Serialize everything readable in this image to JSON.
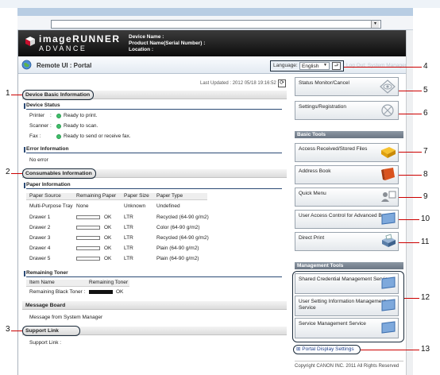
{
  "header": {
    "brand_line1": "imageRUNNER",
    "brand_line2": "ADVANCE",
    "device_name": "Device Name :",
    "product_name": "Product Name(Serial Number) :",
    "location": "Location :"
  },
  "portal": {
    "title": "Remote UI : Portal",
    "language_label": "Language:",
    "language_value": "English",
    "system_manager": "Log Out: System Manager",
    "last_updated": "Last Updated : 2012 05/18 19:16:52"
  },
  "device_basic": {
    "title": "Device Basic Information",
    "status_title": "Device Status",
    "rows": [
      {
        "label": "Printer",
        "sep": ":",
        "value": "Ready to print."
      },
      {
        "label": "Scanner",
        "sep": ":",
        "value": "Ready to scan."
      },
      {
        "label": "Fax :",
        "sep": "",
        "value": "Ready to send or receive fax."
      }
    ],
    "error_title": "Error Information",
    "error_text": "No error"
  },
  "consumables": {
    "title": "Consumables Information",
    "paper_title": "Paper Information",
    "headers": [
      "Paper Source",
      "Remaining Paper",
      "Paper Size",
      "Paper Type"
    ],
    "rows": [
      {
        "source": "Multi-Purpose Tray",
        "remaining": "None",
        "size": "Unknown",
        "type": "Undefined"
      },
      {
        "source": "Drawer 1",
        "remaining": "OK",
        "size": "LTR",
        "type": "Recycled (64-90 g/m2)"
      },
      {
        "source": "Drawer 2",
        "remaining": "OK",
        "size": "LTR",
        "type": "Color (64-90 g/m2)"
      },
      {
        "source": "Drawer 3",
        "remaining": "OK",
        "size": "LTR",
        "type": "Recycled (64-90 g/m2)"
      },
      {
        "source": "Drawer 4",
        "remaining": "OK",
        "size": "LTR",
        "type": "Plain (64-90 g/m2)"
      },
      {
        "source": "Drawer 5",
        "remaining": "OK",
        "size": "LTR",
        "type": "Plain (64-90 g/m2)"
      }
    ],
    "toner_title": "Remaining Toner",
    "toner_headers": [
      "Item Name",
      "Remaining Toner"
    ],
    "toner_item": "Remaining Black Toner :",
    "toner_value": "OK"
  },
  "message_board": {
    "title": "Message Board",
    "text": "Message from System Manager"
  },
  "support": {
    "title": "Support Link",
    "text": "Support Link :"
  },
  "right": {
    "status_monitor": "Status Monitor/Cancel",
    "settings": "Settings/Registration",
    "basic_tools_title": "Basic Tools",
    "basic_tools": [
      "Access Received/Stored Files",
      "Address Book",
      "Quick Menu",
      "User Access Control for Advanced Box",
      "Direct Print"
    ],
    "mgmt_title": "Management Tools",
    "mgmt_tools": [
      "Shared Credential Management Service",
      "User Setting Information Management Service",
      "Service Management Service"
    ],
    "portal_display": "Portal Display Settings",
    "copyright": "Copyright CANON INC. 2011 All Rights Reserved"
  },
  "callouts": [
    "1",
    "2",
    "3",
    "4",
    "5",
    "6",
    "7",
    "8",
    "9",
    "10",
    "11",
    "12",
    "13"
  ],
  "colors": {
    "callout_line": "#cc0000",
    "status_dot": "#3fc06a",
    "banner": "#1a1a1a"
  }
}
